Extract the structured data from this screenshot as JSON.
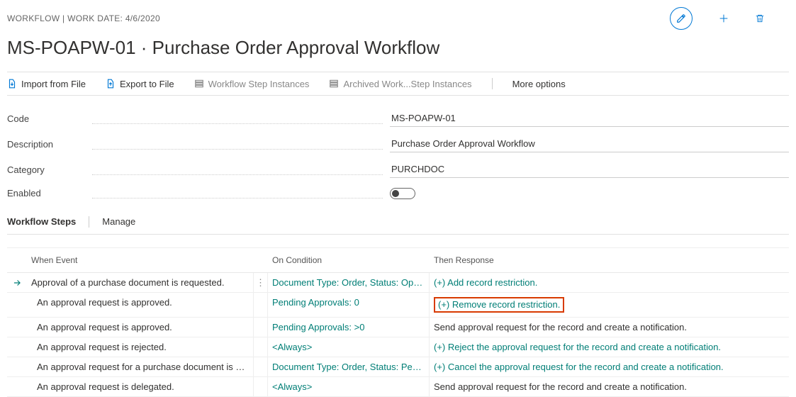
{
  "breadcrumb": "WORKFLOW | WORK DATE: 4/6/2020",
  "page_title": "MS-POAPW-01 · Purchase Order Approval Workflow",
  "top_actions": {
    "edit": "Edit",
    "new": "New",
    "delete": "Delete"
  },
  "action_bar": {
    "import": "Import from File",
    "export": "Export to File",
    "wf_step_instances": "Workflow Step Instances",
    "archived_instances": "Archived Work...Step Instances",
    "more": "More options"
  },
  "fields": {
    "code_label": "Code",
    "code_value": "MS-POAPW-01",
    "description_label": "Description",
    "description_value": "Purchase Order Approval Workflow",
    "category_label": "Category",
    "category_value": "PURCHDOC",
    "enabled_label": "Enabled",
    "enabled_value": false
  },
  "section_tabs": {
    "steps": "Workflow Steps",
    "manage": "Manage"
  },
  "grid": {
    "headers": {
      "when_event": "When Event",
      "on_condition": "On Condition",
      "then_response": "Then Response"
    },
    "rows": [
      {
        "selected": true,
        "event": "Approval of a purchase document is requested.",
        "condition": "Document Type: Order, Status: Open, ...",
        "condition_link": true,
        "response": "(+) Add record restriction.",
        "response_link": true,
        "indent": false,
        "highlight": false
      },
      {
        "event": "An approval request is approved.",
        "condition": "Pending Approvals: 0",
        "condition_link": true,
        "response": "(+) Remove record restriction.",
        "response_link": true,
        "indent": true,
        "highlight": true
      },
      {
        "event": "An approval request is approved.",
        "condition": "Pending Approvals: >0",
        "condition_link": true,
        "response": "Send approval request for the record and create a notification.",
        "response_link": false,
        "indent": true,
        "highlight": false
      },
      {
        "event": "An approval request is rejected.",
        "condition": "<Always>",
        "condition_link": true,
        "response": "(+) Reject the approval request for the record and create a notification.",
        "response_link": true,
        "indent": true,
        "highlight": false
      },
      {
        "event": "An approval request for a purchase document is ca...",
        "condition": "Document Type: Order, Status: Pendin...",
        "condition_link": true,
        "response": "(+) Cancel the approval request for the record and create a notification.",
        "response_link": true,
        "indent": true,
        "highlight": false
      },
      {
        "event": "An approval request is delegated.",
        "condition": "<Always>",
        "condition_link": true,
        "response": "Send approval request for the record and create a notification.",
        "response_link": false,
        "indent": true,
        "highlight": false
      }
    ]
  }
}
